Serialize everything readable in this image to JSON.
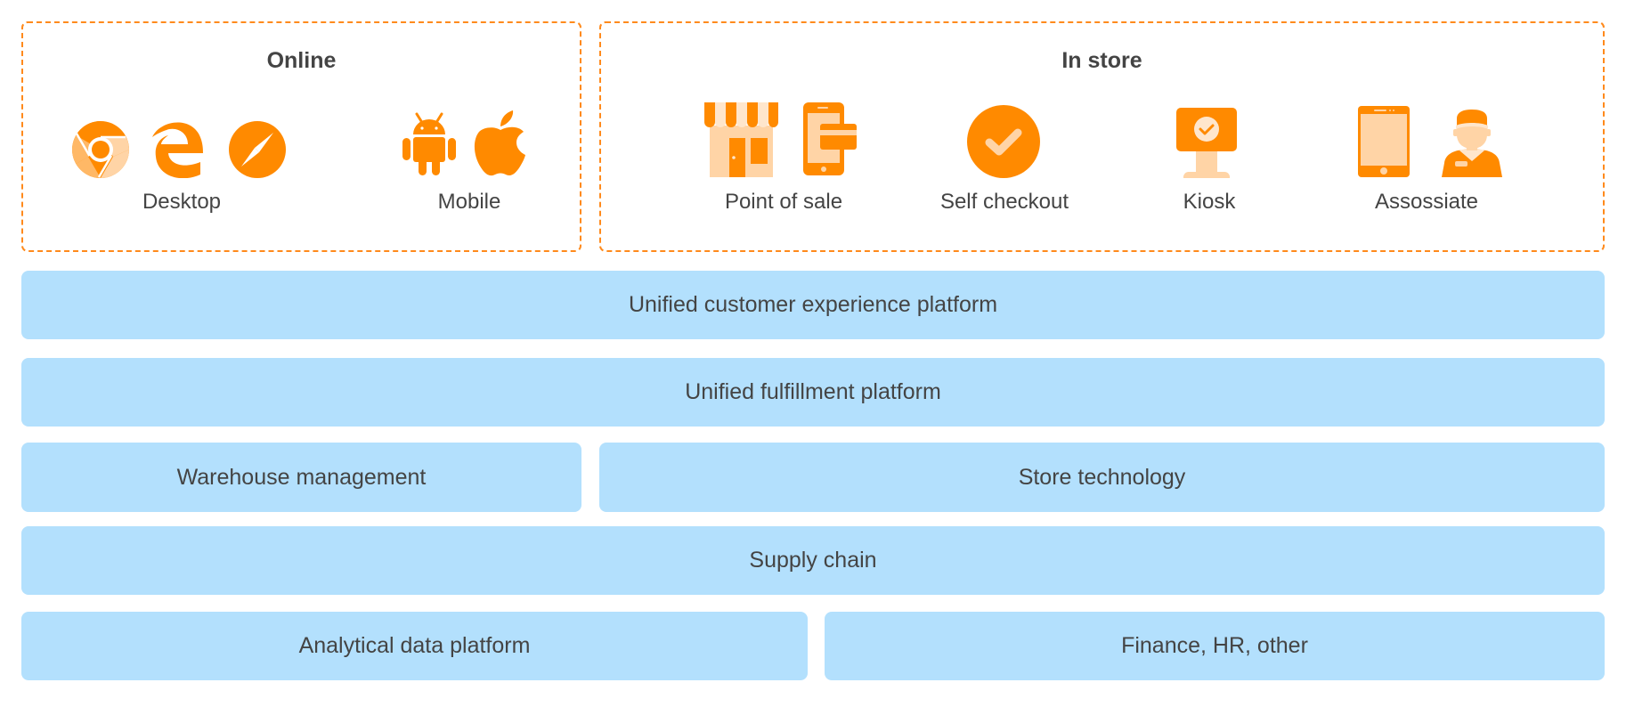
{
  "colors": {
    "accent": "#ff8a00",
    "accent_light": "#ffd4a6",
    "accent_lighter": "#ffe6cc",
    "bar_fill": "#b3e0fd",
    "text": "#444444"
  },
  "channels": {
    "online": {
      "title": "Online",
      "groups": [
        {
          "label": "Desktop",
          "icons": [
            "chrome-icon",
            "edge-icon",
            "safari-icon"
          ]
        },
        {
          "label": "Mobile",
          "icons": [
            "android-icon",
            "apple-icon"
          ]
        }
      ]
    },
    "in_store": {
      "title": "In store",
      "groups": [
        {
          "label": "Point of sale",
          "icons": [
            "storefront-icon",
            "mobile-payment-icon"
          ]
        },
        {
          "label": "Self checkout",
          "icons": [
            "checkmark-circle-icon"
          ]
        },
        {
          "label": "Kiosk",
          "icons": [
            "kiosk-icon"
          ]
        },
        {
          "label": "Assossiate",
          "icons": [
            "tablet-icon",
            "store-associate-icon"
          ]
        }
      ]
    }
  },
  "layers": [
    {
      "label": "Unified customer experience platform"
    },
    {
      "label": "Unified fulfillment platform"
    },
    {
      "label": "Warehouse management"
    },
    {
      "label": "Store technology"
    },
    {
      "label": "Supply chain"
    },
    {
      "label": "Analytical data platform"
    },
    {
      "label": "Finance, HR, other"
    }
  ]
}
